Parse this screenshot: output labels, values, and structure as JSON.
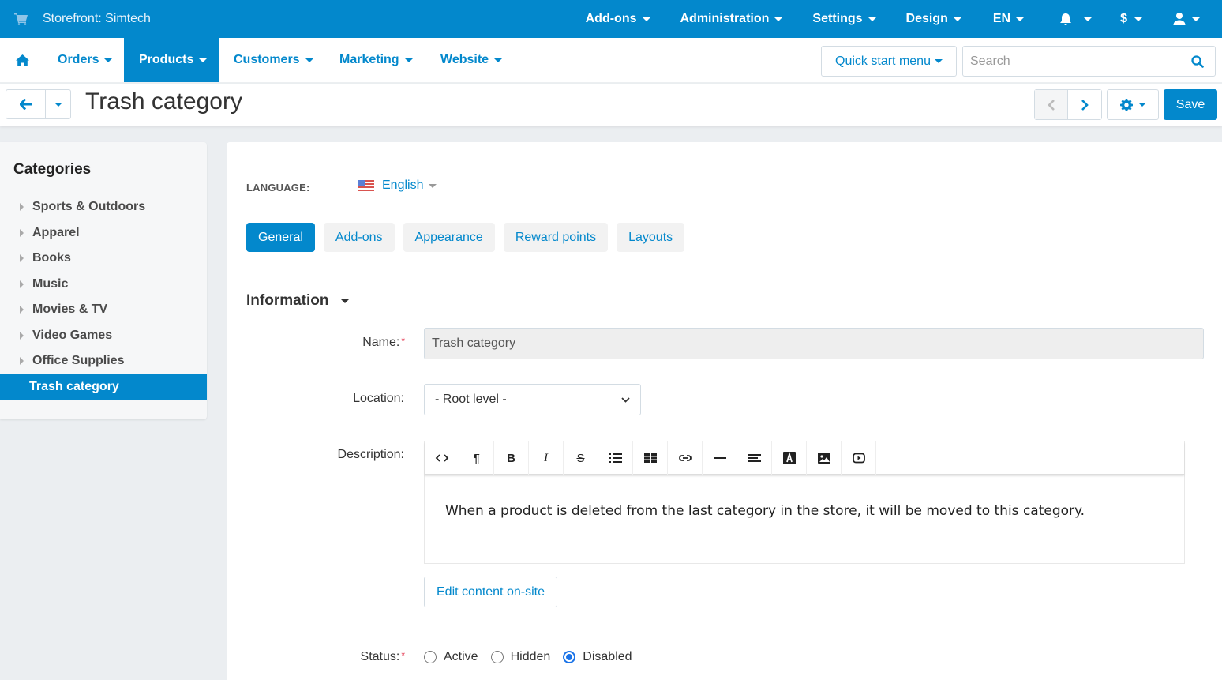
{
  "topbar": {
    "store_label": "Storefront: Simtech",
    "menu": [
      {
        "label": "Add-ons"
      },
      {
        "label": "Administration"
      },
      {
        "label": "Settings"
      },
      {
        "label": "Design"
      },
      {
        "label": "EN"
      },
      {
        "label": "",
        "icon": "bell-icon"
      },
      {
        "label": "$"
      },
      {
        "label": "",
        "icon": "user-icon"
      }
    ]
  },
  "mainnav": {
    "items": [
      {
        "label": "Orders"
      },
      {
        "label": "Products",
        "active": true
      },
      {
        "label": "Customers"
      },
      {
        "label": "Marketing"
      },
      {
        "label": "Website"
      }
    ],
    "quick_start": "Quick start menu",
    "search_placeholder": "Search",
    "search_value": ""
  },
  "pagehead": {
    "title": "Trash category",
    "save_label": "Save"
  },
  "sidebar": {
    "title": "Categories",
    "items": [
      {
        "label": "Sports & Outdoors"
      },
      {
        "label": "Apparel"
      },
      {
        "label": "Books"
      },
      {
        "label": "Music"
      },
      {
        "label": "Movies & TV"
      },
      {
        "label": "Video Games"
      },
      {
        "label": "Office Supplies"
      },
      {
        "label": "Trash category",
        "active": true
      }
    ]
  },
  "content": {
    "language_label": "LANGUAGE:",
    "language_value": "English",
    "tabs": [
      {
        "label": "General",
        "active": true
      },
      {
        "label": "Add-ons"
      },
      {
        "label": "Appearance"
      },
      {
        "label": "Reward points"
      },
      {
        "label": "Layouts"
      }
    ],
    "section_title": "Information",
    "name_label": "Name:",
    "name_value": "Trash category",
    "location_label": "Location:",
    "location_value": "- Root level -",
    "description_label": "Description:",
    "description_text": "When a product is deleted from the last category in the store, it will be moved to this category.",
    "toolbar": [
      "code-view",
      "paragraph",
      "bold",
      "italic",
      "strikethrough",
      "unordered-list",
      "table",
      "link",
      "horizontal-rule",
      "align",
      "text-color",
      "image",
      "video"
    ],
    "edit_on_site": "Edit content on-site",
    "status_label": "Status:",
    "status_options": [
      {
        "label": "Active",
        "checked": false
      },
      {
        "label": "Hidden",
        "checked": false
      },
      {
        "label": "Disabled",
        "checked": true
      }
    ]
  },
  "colors": {
    "brand": "#0388cc",
    "required": "#e3344d"
  }
}
